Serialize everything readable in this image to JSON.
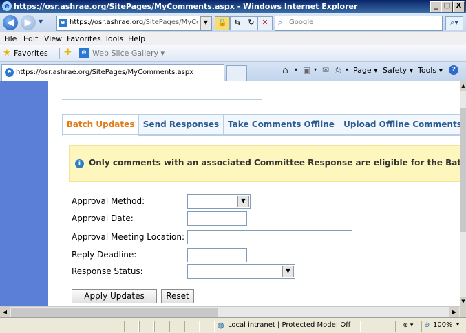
{
  "window": {
    "title": "https://osr.ashrae.org/SitePages/MyComments.aspx - Windows Internet Explorer",
    "min": "_",
    "max": "□",
    "close": "X"
  },
  "address_bar": {
    "url_host": "https://osr.ashrae.org",
    "url_path": "/SitePages/MyCom",
    "search_placeholder": "Google"
  },
  "menu": [
    "File",
    "Edit",
    "View",
    "Favorites",
    "Tools",
    "Help"
  ],
  "favorites_bar": {
    "favorites_label": "Favorites",
    "web_slice_label": "Web Slice Gallery ▾"
  },
  "browser_tab": {
    "label": "https://osr.ashrae.org/SitePages/MyComments.aspx"
  },
  "command_bar": {
    "page": "Page ▾",
    "safety": "Safety ▾",
    "tools": "Tools ▾"
  },
  "page_tabs": [
    "Batch Updates",
    "Send Responses",
    "Take Comments Offline",
    "Upload Offline Comments"
  ],
  "notice": {
    "text": "Only comments with an associated Committee Response are eligible for the Batch Update."
  },
  "form": {
    "approval_method_label": "Approval Method:",
    "approval_date_label": "Approval Date:",
    "meeting_location_label": "Approval Meeting Location:",
    "reply_deadline_label": "Reply Deadline:",
    "response_status_label": "Response Status:"
  },
  "buttons": {
    "apply": "Apply Updates",
    "reset": "Reset"
  },
  "status_bar": {
    "zone": "Local intranet | Protected Mode: Off",
    "zoom": "100%"
  },
  "colors": {
    "accent_orange": "#e07b16",
    "tab_text_blue": "#2a5c8f",
    "notice_bg": "#fdf6bd",
    "left_nav_blue": "#5b7fd6"
  }
}
